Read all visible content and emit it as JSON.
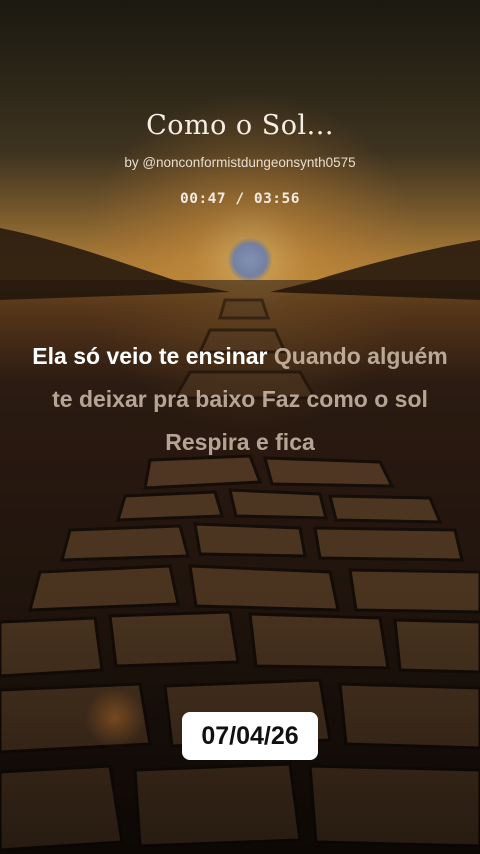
{
  "video": {
    "title": "Como o Sol...",
    "byline": "by @nonconformistdungeonsynth0575",
    "time_current": "00:47",
    "time_separator": " / ",
    "time_total": "03:56"
  },
  "lyrics": {
    "sung": "Ela só veio te ensinar",
    "upcoming_1": " Quando alguém te deixar pra baixo",
    "upcoming_2": " Faz como o sol Respira e fica"
  },
  "badge": {
    "date": "07/04/26"
  },
  "colors": {
    "sky_top": "#3a3024",
    "horizon_glow": "#e9a63c",
    "sun": "#8fa0c8",
    "stone": "#6b4a2c",
    "badge_bg": "#ffffff"
  }
}
